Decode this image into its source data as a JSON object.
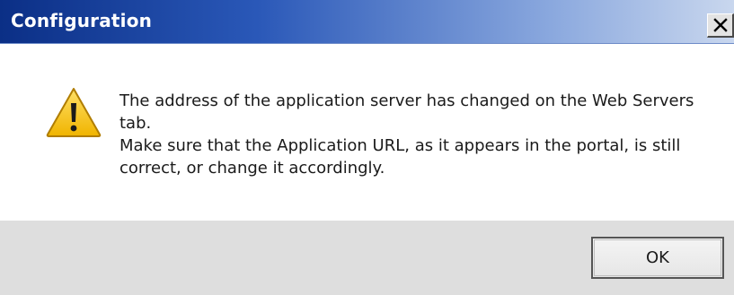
{
  "window": {
    "title": "Configuration",
    "close_icon": "close-icon"
  },
  "message": {
    "icon": "warning-icon",
    "line1": "The address of the application server has changed on the Web Servers tab.",
    "line2": "Make sure that the Application URL, as it appears in the portal, is still correct, or change it accordingly."
  },
  "buttons": {
    "ok_label": "OK"
  },
  "colors": {
    "titlebar_start": "#0b2f86",
    "titlebar_end": "#c9d7ee",
    "warning_fill": "#f6c31b",
    "footer_bg": "#dedede"
  }
}
